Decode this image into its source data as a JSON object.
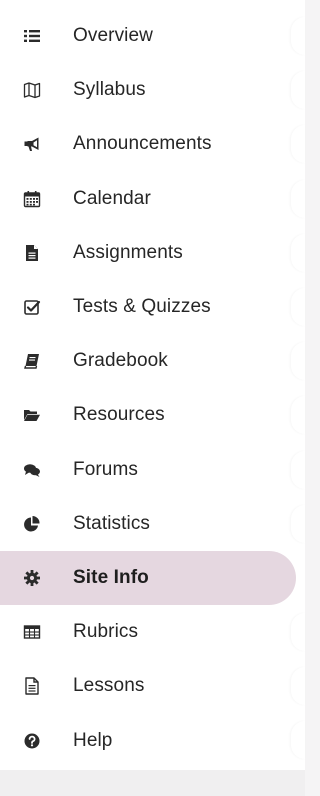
{
  "sidebar": {
    "items": [
      {
        "label": "Overview",
        "icon": "list-icon",
        "active": false
      },
      {
        "label": "Syllabus",
        "icon": "map-icon",
        "active": false
      },
      {
        "label": "Announcements",
        "icon": "megaphone-icon",
        "active": false
      },
      {
        "label": "Calendar",
        "icon": "calendar-icon",
        "active": false
      },
      {
        "label": "Assignments",
        "icon": "document-icon",
        "active": false
      },
      {
        "label": "Tests & Quizzes",
        "icon": "checkbox-icon",
        "active": false
      },
      {
        "label": "Gradebook",
        "icon": "book-icon",
        "active": false
      },
      {
        "label": "Resources",
        "icon": "folder-open-icon",
        "active": false
      },
      {
        "label": "Forums",
        "icon": "comments-icon",
        "active": false
      },
      {
        "label": "Statistics",
        "icon": "pie-chart-icon",
        "active": false
      },
      {
        "label": "Site Info",
        "icon": "gear-icon",
        "active": true
      },
      {
        "label": "Rubrics",
        "icon": "table-icon",
        "active": false
      },
      {
        "label": "Lessons",
        "icon": "file-text-icon",
        "active": false
      },
      {
        "label": "Help",
        "icon": "question-circle-icon",
        "active": false
      }
    ]
  },
  "colors": {
    "active_background": "#e5d7e0",
    "text": "#262626"
  }
}
